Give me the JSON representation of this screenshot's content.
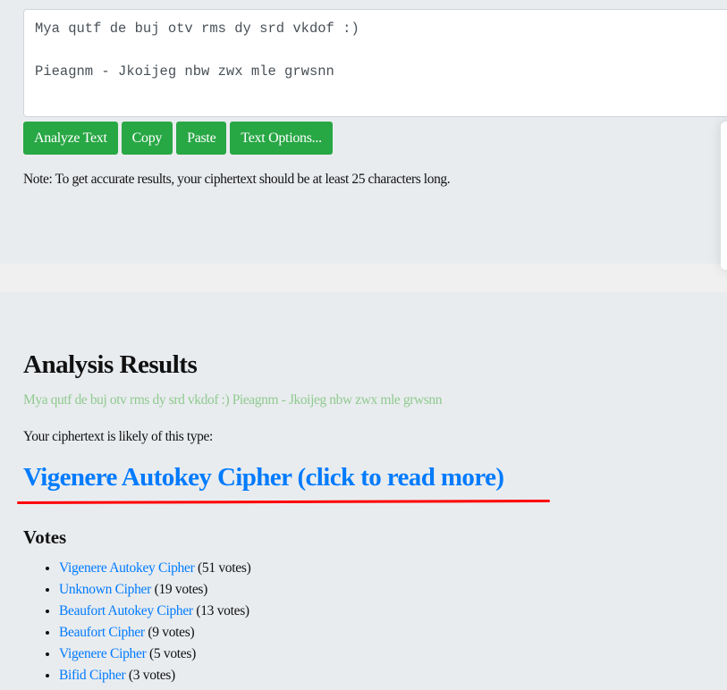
{
  "input": {
    "value": "Mya qutf de buj otv rms dy srd vkdof :)\n\nPieagnm - Jkoijeg nbw zwx mle grwsnn"
  },
  "buttons": {
    "analyze": "Analyze Text",
    "copy": "Copy",
    "paste": "Paste",
    "options": "Text Options..."
  },
  "note": "Note: To get accurate results, your ciphertext should be at least 25 characters long.",
  "results": {
    "title": "Analysis Results",
    "echo": "Mya qutf de buj otv rms dy srd vkdof :) Pieagnm - Jkoijeg nbw zwx mle grwsnn",
    "likely_label": "Your ciphertext is likely of this type:",
    "top_result": "Vigenere Autokey Cipher (click to read more)",
    "votes_title": "Votes",
    "votes": [
      {
        "name": "Vigenere Autokey Cipher",
        "count": "(51 votes)"
      },
      {
        "name": "Unknown Cipher",
        "count": "(19 votes)"
      },
      {
        "name": "Beaufort Autokey Cipher",
        "count": "(13 votes)"
      },
      {
        "name": "Beaufort Cipher",
        "count": "(9 votes)"
      },
      {
        "name": "Vigenere Cipher",
        "count": "(5 votes)"
      },
      {
        "name": "Bifid Cipher",
        "count": "(3 votes)"
      }
    ]
  },
  "colors": {
    "button": "#28a745",
    "link": "#007bff",
    "echo": "#8fca8f",
    "annotation": "#ff0000"
  }
}
